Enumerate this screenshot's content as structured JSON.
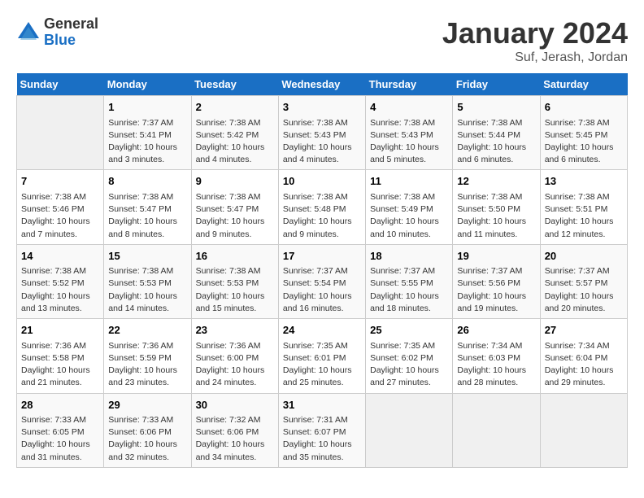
{
  "header": {
    "logo": {
      "general": "General",
      "blue": "Blue"
    },
    "title": "January 2024",
    "location": "Suf, Jerash, Jordan"
  },
  "calendar": {
    "days_of_week": [
      "Sunday",
      "Monday",
      "Tuesday",
      "Wednesday",
      "Thursday",
      "Friday",
      "Saturday"
    ],
    "weeks": [
      [
        {
          "day": "",
          "info": ""
        },
        {
          "day": "1",
          "info": "Sunrise: 7:37 AM\nSunset: 5:41 PM\nDaylight: 10 hours\nand 3 minutes."
        },
        {
          "day": "2",
          "info": "Sunrise: 7:38 AM\nSunset: 5:42 PM\nDaylight: 10 hours\nand 4 minutes."
        },
        {
          "day": "3",
          "info": "Sunrise: 7:38 AM\nSunset: 5:43 PM\nDaylight: 10 hours\nand 4 minutes."
        },
        {
          "day": "4",
          "info": "Sunrise: 7:38 AM\nSunset: 5:43 PM\nDaylight: 10 hours\nand 5 minutes."
        },
        {
          "day": "5",
          "info": "Sunrise: 7:38 AM\nSunset: 5:44 PM\nDaylight: 10 hours\nand 6 minutes."
        },
        {
          "day": "6",
          "info": "Sunrise: 7:38 AM\nSunset: 5:45 PM\nDaylight: 10 hours\nand 6 minutes."
        }
      ],
      [
        {
          "day": "7",
          "info": "Sunrise: 7:38 AM\nSunset: 5:46 PM\nDaylight: 10 hours\nand 7 minutes."
        },
        {
          "day": "8",
          "info": "Sunrise: 7:38 AM\nSunset: 5:47 PM\nDaylight: 10 hours\nand 8 minutes."
        },
        {
          "day": "9",
          "info": "Sunrise: 7:38 AM\nSunset: 5:47 PM\nDaylight: 10 hours\nand 9 minutes."
        },
        {
          "day": "10",
          "info": "Sunrise: 7:38 AM\nSunset: 5:48 PM\nDaylight: 10 hours\nand 9 minutes."
        },
        {
          "day": "11",
          "info": "Sunrise: 7:38 AM\nSunset: 5:49 PM\nDaylight: 10 hours\nand 10 minutes."
        },
        {
          "day": "12",
          "info": "Sunrise: 7:38 AM\nSunset: 5:50 PM\nDaylight: 10 hours\nand 11 minutes."
        },
        {
          "day": "13",
          "info": "Sunrise: 7:38 AM\nSunset: 5:51 PM\nDaylight: 10 hours\nand 12 minutes."
        }
      ],
      [
        {
          "day": "14",
          "info": "Sunrise: 7:38 AM\nSunset: 5:52 PM\nDaylight: 10 hours\nand 13 minutes."
        },
        {
          "day": "15",
          "info": "Sunrise: 7:38 AM\nSunset: 5:53 PM\nDaylight: 10 hours\nand 14 minutes."
        },
        {
          "day": "16",
          "info": "Sunrise: 7:38 AM\nSunset: 5:53 PM\nDaylight: 10 hours\nand 15 minutes."
        },
        {
          "day": "17",
          "info": "Sunrise: 7:37 AM\nSunset: 5:54 PM\nDaylight: 10 hours\nand 16 minutes."
        },
        {
          "day": "18",
          "info": "Sunrise: 7:37 AM\nSunset: 5:55 PM\nDaylight: 10 hours\nand 18 minutes."
        },
        {
          "day": "19",
          "info": "Sunrise: 7:37 AM\nSunset: 5:56 PM\nDaylight: 10 hours\nand 19 minutes."
        },
        {
          "day": "20",
          "info": "Sunrise: 7:37 AM\nSunset: 5:57 PM\nDaylight: 10 hours\nand 20 minutes."
        }
      ],
      [
        {
          "day": "21",
          "info": "Sunrise: 7:36 AM\nSunset: 5:58 PM\nDaylight: 10 hours\nand 21 minutes."
        },
        {
          "day": "22",
          "info": "Sunrise: 7:36 AM\nSunset: 5:59 PM\nDaylight: 10 hours\nand 23 minutes."
        },
        {
          "day": "23",
          "info": "Sunrise: 7:36 AM\nSunset: 6:00 PM\nDaylight: 10 hours\nand 24 minutes."
        },
        {
          "day": "24",
          "info": "Sunrise: 7:35 AM\nSunset: 6:01 PM\nDaylight: 10 hours\nand 25 minutes."
        },
        {
          "day": "25",
          "info": "Sunrise: 7:35 AM\nSunset: 6:02 PM\nDaylight: 10 hours\nand 27 minutes."
        },
        {
          "day": "26",
          "info": "Sunrise: 7:34 AM\nSunset: 6:03 PM\nDaylight: 10 hours\nand 28 minutes."
        },
        {
          "day": "27",
          "info": "Sunrise: 7:34 AM\nSunset: 6:04 PM\nDaylight: 10 hours\nand 29 minutes."
        }
      ],
      [
        {
          "day": "28",
          "info": "Sunrise: 7:33 AM\nSunset: 6:05 PM\nDaylight: 10 hours\nand 31 minutes."
        },
        {
          "day": "29",
          "info": "Sunrise: 7:33 AM\nSunset: 6:06 PM\nDaylight: 10 hours\nand 32 minutes."
        },
        {
          "day": "30",
          "info": "Sunrise: 7:32 AM\nSunset: 6:06 PM\nDaylight: 10 hours\nand 34 minutes."
        },
        {
          "day": "31",
          "info": "Sunrise: 7:31 AM\nSunset: 6:07 PM\nDaylight: 10 hours\nand 35 minutes."
        },
        {
          "day": "",
          "info": ""
        },
        {
          "day": "",
          "info": ""
        },
        {
          "day": "",
          "info": ""
        }
      ]
    ]
  }
}
